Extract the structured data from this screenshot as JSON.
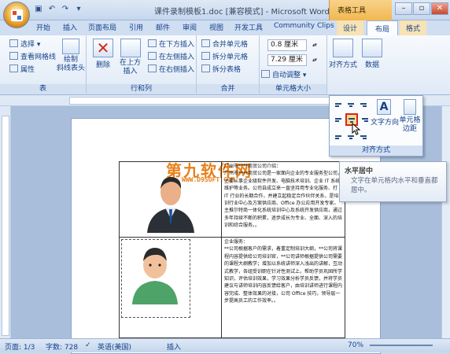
{
  "title": "课件录制模板1.doc [兼容模式] - Microsoft Word",
  "tools_tab": "表格工具",
  "qat": [
    "save-icon",
    "undo-icon",
    "redo-icon"
  ],
  "window_controls": [
    "–",
    "▫",
    "✕"
  ],
  "tabs": [
    "开始",
    "插入",
    "页面布局",
    "引用",
    "邮件",
    "审阅",
    "视图",
    "开发工具",
    "Community Clips",
    "设计",
    "布局",
    "格式"
  ],
  "ribbon": {
    "table_group": {
      "title": "表",
      "select": "选择 ▾",
      "gridlines": "查看网格线",
      "properties": "属性"
    },
    "draw": {
      "label": "绘制\n斜线表头"
    },
    "rows_cols": {
      "title": "行和列",
      "delete": "删除",
      "insert_above": "在上方\n插入",
      "insert_below": "在下方插入",
      "insert_left": "在左侧插入",
      "insert_right": "在右侧插入"
    },
    "merge": {
      "title": "合并",
      "merge_cells": "合并单元格",
      "split_cells": "拆分单元格",
      "split_table": "拆分表格"
    },
    "cell_size": {
      "title": "单元格大小",
      "height": "0.8 厘米",
      "width": "7.29 厘米",
      "auto_fit": "自动调整 ▾"
    },
    "alignment": {
      "label": "对齐方式"
    },
    "data": {
      "label": "数据"
    }
  },
  "dropdown": {
    "text_direction": "文字方向",
    "cell_margins": "单元格\n边距",
    "title": "对齐方式"
  },
  "tooltip": {
    "title": "水平居中",
    "body": "文字在单元格内水平和垂直都居中。"
  },
  "watermark": {
    "main": "第九软件网",
    "sub": "WWW.D9SOFT.COM"
  },
  "table": {
    "row1_text": "广州市****商贸公司介绍：\n广州市****商贸公司是一家面向企业的专业服务型公司，主要从事企业级软件开发、电脑技术培训、企业 IT 系统维护等业务。公司自成立来一直坚持用专业化服务、打 IT 行业的长期合作，并建立起稳定合作伙伴关系，是培训行业中心及方案供应商、Office 办公应用开发专家。主推尔特商一体化系统培训中心及系统开发供应商，通过多年持续不断的积累，逐步成长为专业、全面、深入的培训和综合服务。。",
    "row2_text": "企业服务：\n**公司根据客户的需求，着重定制培训大纲，**公司将课程内容提供给公司培训官，**公司讲师根据提供公司需要的课程大纲教学；增加以系统讲师深入浅出的讲解，互动式教学，各组受训职在针对性测试上，帮助学员巩固所学知识，评估培训效果，学习效果分析学员反馈，并将学员建议与讲师培训内容反馈给客户，由培训讲师进行课程内容完成、整体效果的对接，公司 Office 技巧，领导层一步提高员工的工作效率。。"
  },
  "status": {
    "page": "页面: 1/3",
    "words": "字数: 728",
    "lang": "英语(美国)",
    "mode": "插入",
    "zoom": "70%"
  }
}
